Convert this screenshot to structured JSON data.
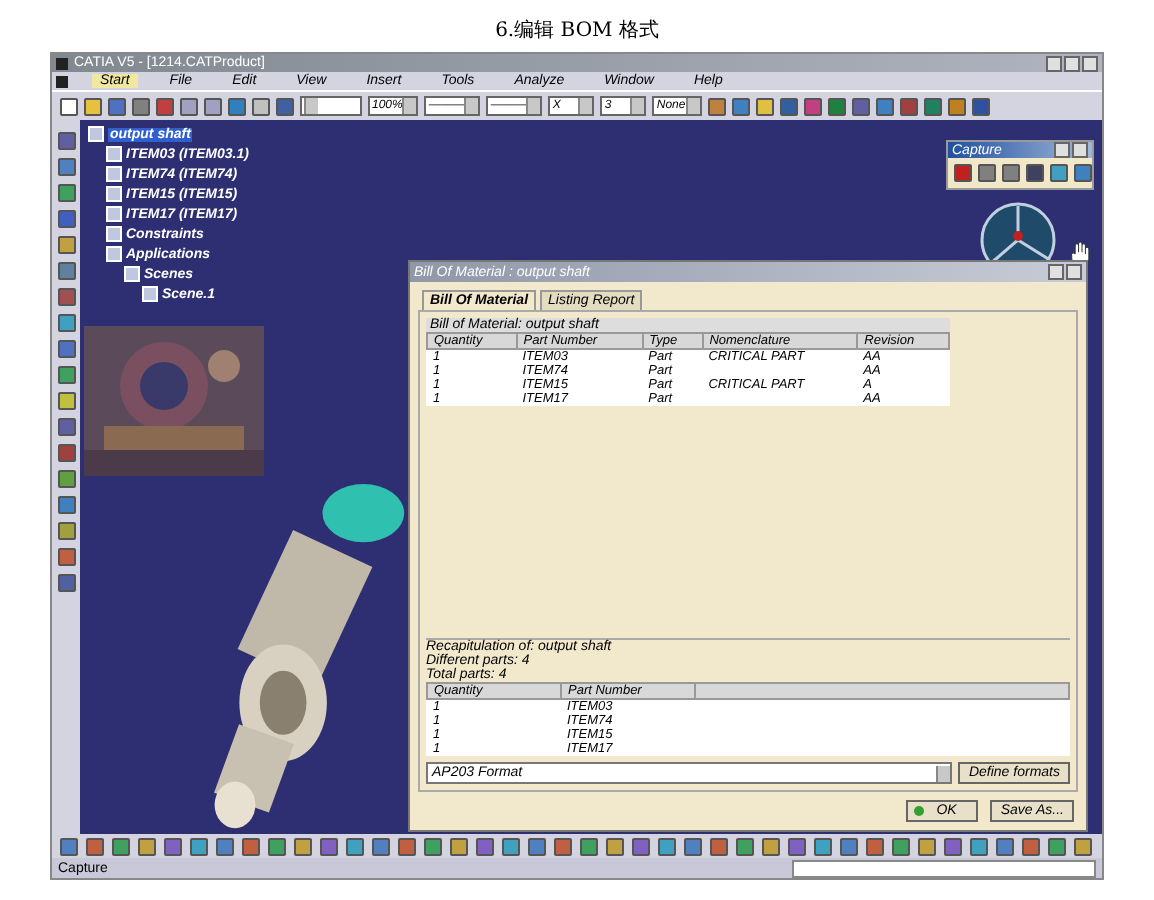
{
  "caption": "6.编辑 BOM 格式",
  "window": {
    "title": "CATIA V5 - [1214.CATProduct]"
  },
  "menu": [
    {
      "label": "Start",
      "selected": true
    },
    {
      "label": "File",
      "selected": false
    },
    {
      "label": "Edit",
      "selected": false
    },
    {
      "label": "View",
      "selected": false
    },
    {
      "label": "Insert",
      "selected": false
    },
    {
      "label": "Tools",
      "selected": false
    },
    {
      "label": "Analyze",
      "selected": false
    },
    {
      "label": "Window",
      "selected": false
    },
    {
      "label": "Help",
      "selected": false
    }
  ],
  "toolbar_combos": [
    {
      "value": "100%"
    },
    {
      "value": "———"
    },
    {
      "value": "———"
    },
    {
      "value": "X"
    },
    {
      "value": "3"
    },
    {
      "value": "None"
    }
  ],
  "tree": {
    "label": "output shaft",
    "selected": true,
    "children": [
      {
        "label": "ITEM03 (ITEM03.1)",
        "selected": false
      },
      {
        "label": "ITEM74 (ITEM74)",
        "selected": false
      },
      {
        "label": "ITEM15 (ITEM15)",
        "selected": false
      },
      {
        "label": "ITEM17 (ITEM17)",
        "selected": false
      },
      {
        "label": "Constraints",
        "selected": false
      },
      {
        "label": "Applications",
        "selected": false,
        "children": [
          {
            "label": "Scenes",
            "selected": false,
            "children": [
              {
                "label": "Scene.1",
                "selected": false
              }
            ]
          }
        ]
      }
    ]
  },
  "capture_toolbar": {
    "title": "Capture"
  },
  "dialog": {
    "title": "Bill Of Material : output shaft",
    "tabs": [
      {
        "label": "Bill Of Material",
        "selected": true
      },
      {
        "label": "Listing Report",
        "selected": false
      }
    ],
    "bom_title": "Bill of Material: output shaft",
    "columns": [
      "Quantity",
      "Part Number",
      "Type",
      "Nomenclature",
      "Revision"
    ],
    "rows": [
      [
        "1",
        "ITEM03",
        "Part",
        "CRITICAL PART",
        "AA"
      ],
      [
        "1",
        "ITEM74",
        "Part",
        "",
        "AA"
      ],
      [
        "1",
        "ITEM15",
        "Part",
        "CRITICAL PART",
        "A"
      ],
      [
        "1",
        "ITEM17",
        "Part",
        "",
        "AA"
      ]
    ],
    "recap_lines": [
      "Recapitulation of: output shaft",
      "Different parts: 4",
      "Total parts: 4"
    ],
    "recap_columns": [
      "Quantity",
      "Part Number"
    ],
    "recap_rows": [
      [
        "1",
        "ITEM03"
      ],
      [
        "1",
        "ITEM74"
      ],
      [
        "1",
        "ITEM15"
      ],
      [
        "1",
        "ITEM17"
      ]
    ],
    "format": {
      "value": "AP203 Format"
    },
    "define_button": "Define formats",
    "ok_button": "OK",
    "save_button": "Save As..."
  },
  "status_bar": {
    "text": "Capture"
  }
}
